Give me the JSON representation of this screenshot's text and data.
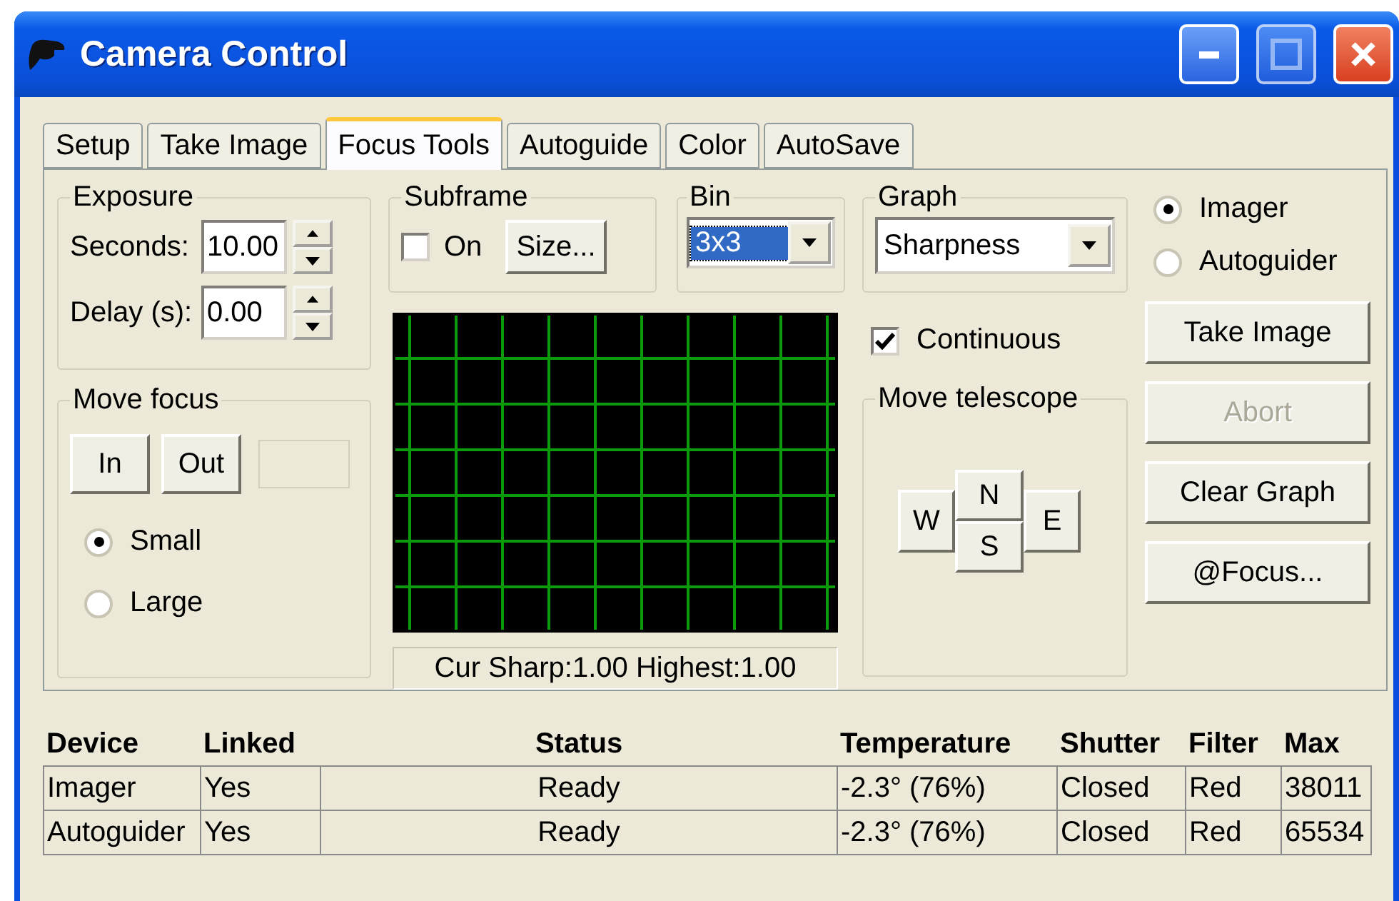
{
  "window": {
    "title": "Camera Control"
  },
  "tabs": [
    {
      "label": "Setup",
      "selected": false
    },
    {
      "label": "Take Image",
      "selected": false
    },
    {
      "label": "Focus Tools",
      "selected": true
    },
    {
      "label": "Autoguide",
      "selected": false
    },
    {
      "label": "Color",
      "selected": false
    },
    {
      "label": "AutoSave",
      "selected": false
    }
  ],
  "exposure": {
    "title": "Exposure",
    "fields": [
      {
        "label": "Seconds:",
        "value": "10.00"
      },
      {
        "label": "Delay (s):",
        "value": "0.00"
      }
    ]
  },
  "move_focus": {
    "title": "Move focus",
    "buttons": [
      "In",
      "Out"
    ],
    "step_sizes": [
      {
        "label": "Small",
        "selected": true
      },
      {
        "label": "Large",
        "selected": false
      }
    ]
  },
  "subframe": {
    "title": "Subframe",
    "on": {
      "label": "On",
      "checked": false
    },
    "size_button": "Size..."
  },
  "bin": {
    "title": "Bin",
    "value": "3x3",
    "focused": true
  },
  "graph_status": "Cur Sharp:1.00 Highest:1.00",
  "graph": {
    "title": "Graph",
    "value": "Sharpness"
  },
  "continuous": {
    "label": "Continuous",
    "checked": true
  },
  "move_telescope": {
    "title": "Move telescope",
    "buttons": [
      {
        "label": "N",
        "kind": "north"
      },
      {
        "label": "W",
        "kind": "west"
      },
      {
        "label": "S",
        "kind": "south"
      },
      {
        "label": "E",
        "kind": "east"
      }
    ]
  },
  "camera": [
    {
      "label": "Imager",
      "selected": true
    },
    {
      "label": "Autoguider",
      "selected": false
    }
  ],
  "buttons": [
    {
      "label": "Take Image",
      "disabled": false
    },
    {
      "label": "Abort",
      "disabled": true
    },
    {
      "label": "Clear Graph",
      "disabled": false
    },
    {
      "label": "@Focus...",
      "disabled": false
    }
  ],
  "table": {
    "columns": [
      "Device",
      "Linked",
      "Status",
      "Temperature",
      "Shutter",
      "Filter",
      "Max"
    ],
    "rows": [
      [
        "Imager",
        "Yes",
        "Ready",
        "-2.3° (76%)",
        "Closed",
        "Red",
        "38011"
      ],
      [
        "Autoguider",
        "Yes",
        "Ready",
        "-2.3° (76%)",
        "Closed",
        "Red",
        "65534"
      ]
    ]
  }
}
